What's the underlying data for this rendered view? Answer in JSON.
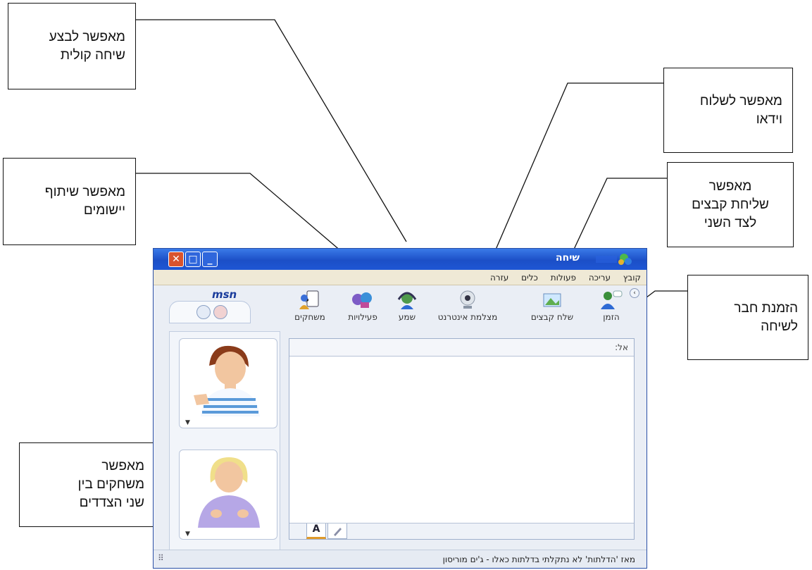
{
  "callouts": {
    "voice_call": [
      "מאפשר לבצע",
      "שיחה קולית"
    ],
    "send_video": [
      "מאפשר לשלוח",
      "וידאו"
    ],
    "app_sharing": [
      "מאפשר שיתוף",
      "יישומים"
    ],
    "send_files": [
      "מאפשר",
      "שליחת קבצים",
      "לצד השני"
    ],
    "invite_friend": [
      "הזמנת חבר",
      "לשיחה"
    ],
    "games": [
      "מאפשר",
      "משחקים בין",
      "שני הצדדים"
    ]
  },
  "window": {
    "title": "שיחה",
    "menu": [
      "קובץ",
      "עריכה",
      "פעולות",
      "כלים",
      "עזרה"
    ],
    "logo": "msn",
    "toolbar": {
      "invite": "הזמן",
      "send_files": "שלח קבצים",
      "webcam": "מצלמת אינטרנט",
      "audio": "שמע",
      "activities": "פעילויות",
      "games": "משחקים"
    },
    "to_label": "אל:",
    "font_tab": "A",
    "status": "מאז 'הדלתות' לא נתקלתי בדלתות כאלו - ג'ים מוריסון"
  },
  "colors": {
    "titlebar": "#1e56d4",
    "menubar": "#efe9d6",
    "close_button": "#d9532c",
    "window_body": "#eaeef5"
  }
}
